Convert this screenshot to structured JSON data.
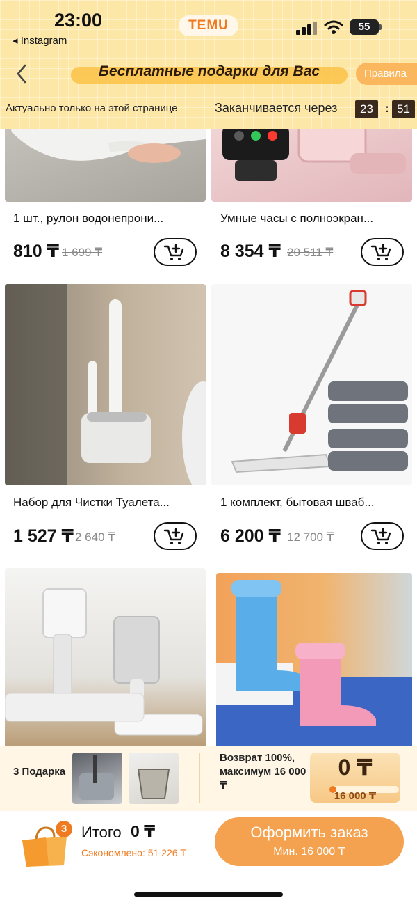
{
  "status_bar": {
    "time": "23:00",
    "back_app": "◂ Instagram",
    "logo": "TEMU",
    "battery": "55"
  },
  "header": {
    "title": "Бесплатные подарки для Вас",
    "rules_label": "Правила",
    "timer_note": "Актуально только на этой странице",
    "timer_label": "Заканчивается через",
    "timer_hours": "23",
    "timer_minutes": "51"
  },
  "products": [
    {
      "name": "1 шт., рулон водонепрони...",
      "price": "810 ₸",
      "old_price": "1 699 ₸"
    },
    {
      "name": "Умные часы с полноэкран...",
      "price": "8 354 ₸",
      "old_price": "20 511 ₸"
    },
    {
      "name": "Набор для Чистки Туалета...",
      "price": "1 527 ₸",
      "old_price": "2 640 ₸"
    },
    {
      "name": "1 комплект, бытовая шваб...",
      "price": "6 200 ₸",
      "old_price": "12 700 ₸"
    }
  ],
  "gifts": {
    "count_label": "3 Подарка",
    "refund_text": "Возврат 100%, максимум 16 000 ₸",
    "refund_value": "0 ₸",
    "refund_goal": "16 000 ₸",
    "refund_progress": 0.03
  },
  "checkout": {
    "bag_badge": "3",
    "total_label": "Итого",
    "total_value": "0 ₸",
    "saved": "Сэкономлено: 51 226 ₸",
    "button_label": "Оформить заказ",
    "button_min": "Мин. 16 000 ₸"
  },
  "colors": {
    "accent": "#f07a1f",
    "header_bg": "#fde7a6",
    "checkout_button": "#f4a24f"
  }
}
